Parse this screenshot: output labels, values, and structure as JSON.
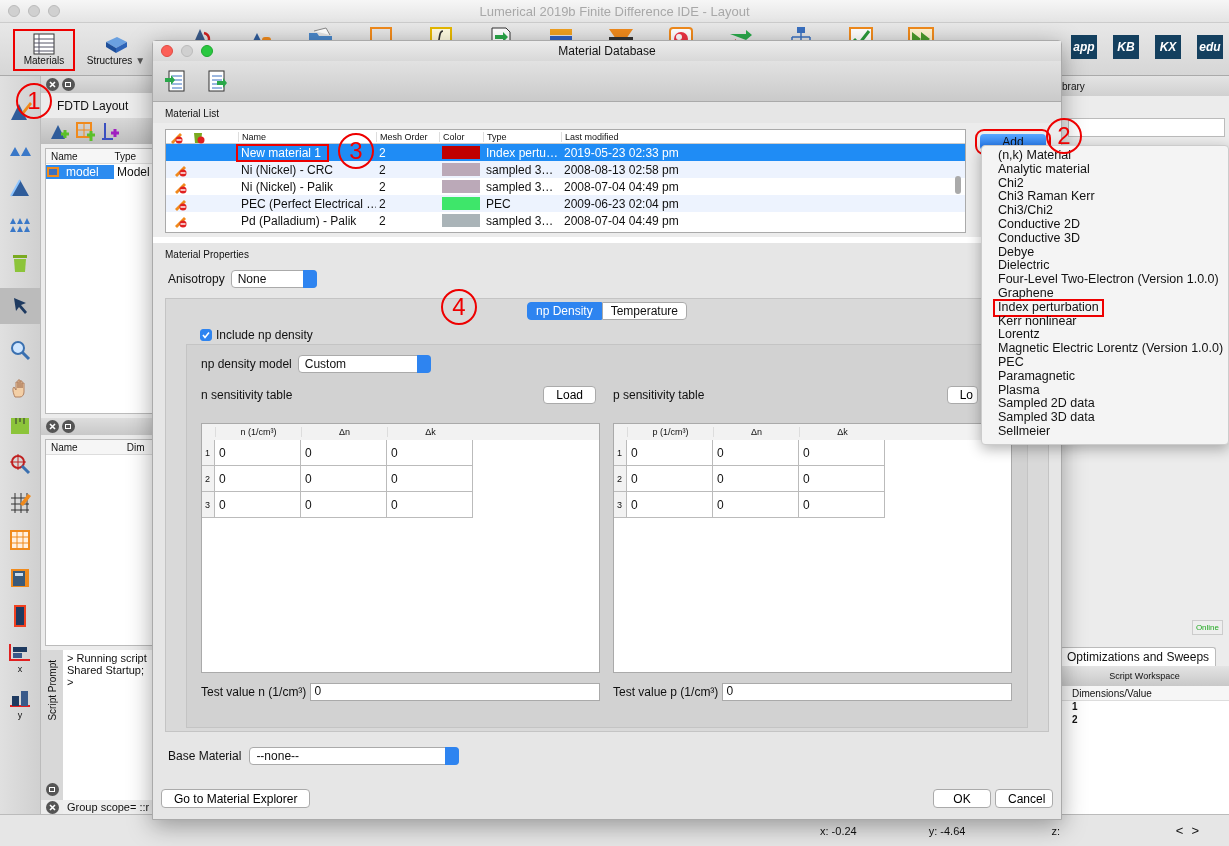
{
  "window": {
    "title": "Lumerical 2019b Finite Difference IDE - Layout"
  },
  "toolbar": {
    "buttons": [
      {
        "label": "Materials",
        "outlined": true
      },
      {
        "label": "Structures",
        "caret": "▼",
        "outlined": false
      }
    ],
    "logos": [
      "app",
      "KB",
      "KX",
      "edu"
    ]
  },
  "left_panel": {
    "title": "FDTD Layout",
    "columns": [
      "Name",
      "Type"
    ],
    "rows": [
      {
        "name": "model",
        "type": "Model",
        "selected": true
      }
    ]
  },
  "result_panel": {
    "columns": [
      "Name",
      "Dim"
    ]
  },
  "script_prompt": {
    "tab": "Script Prompt",
    "lines": [
      "> Running script",
      "Shared Startup;",
      ">"
    ],
    "scope": "Group scope= ::r"
  },
  "icon_bar": {
    "x_label": "x",
    "y_label": "y"
  },
  "right_panel": {
    "tab": "brary",
    "status": "Online",
    "tabs": [
      {
        "label": "Optimizations and Sweeps",
        "selected": true
      }
    ],
    "workspace_title": "Script Workspace",
    "columns": [
      "Dimensions/Value"
    ],
    "rows": [
      "1",
      "2"
    ]
  },
  "status_bar": {
    "x": "x: -0.24",
    "y": "y: -4.64",
    "z": "z:",
    "nav": [
      "<",
      ">"
    ]
  },
  "dialog": {
    "title": "Material Database",
    "list_label": "Material List",
    "columns": [
      "Name",
      "Mesh Order",
      "Color",
      "Type",
      "Last modified"
    ],
    "rows": [
      {
        "name": "New material 1",
        "mesh_order": "2",
        "color": "#c00000",
        "type": "Index pertu…",
        "modified": "2019-05-23 02:33 pm",
        "selected": true,
        "outlined": true,
        "removable": false
      },
      {
        "name": "Ni (Nickel) - CRC",
        "mesh_order": "2",
        "color": "#bba9b8",
        "type": "sampled 3…",
        "modified": "2008-08-13 02:58 pm",
        "selected": false,
        "outlined": false,
        "removable": true
      },
      {
        "name": "Ni (Nickel) - Palik",
        "mesh_order": "2",
        "color": "#bba9b8",
        "type": "sampled 3…",
        "modified": "2008-07-04 04:49 pm",
        "selected": false,
        "outlined": false,
        "removable": true
      },
      {
        "name": "PEC (Perfect Electrical …",
        "mesh_order": "2",
        "color": "#3ee66a",
        "type": "PEC",
        "modified": "2009-06-23 02:04 pm",
        "selected": false,
        "outlined": false,
        "removable": true
      },
      {
        "name": "Pd (Palladium) - Palik",
        "mesh_order": "2",
        "color": "#aab4b8",
        "type": "sampled 3…",
        "modified": "2008-07-04 04:49 pm",
        "selected": false,
        "outlined": false,
        "removable": true
      }
    ],
    "add_button": {
      "label": "Add",
      "outlined": true
    },
    "properties_label": "Material Properties",
    "anisotropy": {
      "label": "Anisotropy",
      "value": "None"
    },
    "tabs": [
      {
        "label": "np Density",
        "selected": true
      },
      {
        "label": "Temperature",
        "selected": false
      }
    ],
    "include": {
      "label": "Include np density",
      "checked": true
    },
    "model": {
      "label": "np density model",
      "value": "Custom"
    },
    "tables": [
      {
        "title": "n sensitivity table",
        "load": "Load",
        "columns": [
          "n (1/cm³)",
          "Δn",
          "Δk"
        ],
        "row_numbers": [
          "1",
          "2",
          "3"
        ],
        "rows": [
          [
            "0",
            "0",
            "0"
          ],
          [
            "0",
            "0",
            "0"
          ],
          [
            "0",
            "0",
            "0"
          ]
        ],
        "test_label": "Test value n (1/cm³)",
        "test_value": "0"
      },
      {
        "title": "p sensitivity table",
        "load": "Lo",
        "columns": [
          "p (1/cm³)",
          "Δn",
          "Δk"
        ],
        "row_numbers": [
          "1",
          "2",
          "3"
        ],
        "rows": [
          [
            "0",
            "0",
            "0"
          ],
          [
            "0",
            "0",
            "0"
          ],
          [
            "0",
            "0",
            "0"
          ]
        ],
        "test_label": "Test value p (1/cm³)",
        "test_value": "0"
      }
    ],
    "base_material": {
      "label": "Base Material",
      "value": "--none--"
    },
    "explorer_button": "Go to Material Explorer",
    "buttons": [
      "OK",
      "Cancel"
    ]
  },
  "add_menu": {
    "items": [
      {
        "label": "(n,k) Material",
        "outlined": false
      },
      {
        "label": "Analytic material",
        "outlined": false
      },
      {
        "label": "Chi2",
        "outlined": false
      },
      {
        "label": "Chi3 Raman Kerr",
        "outlined": false
      },
      {
        "label": "Chi3/Chi2",
        "outlined": false
      },
      {
        "label": "Conductive 2D",
        "outlined": false
      },
      {
        "label": "Conductive 3D",
        "outlined": false
      },
      {
        "label": "Debye",
        "outlined": false
      },
      {
        "label": "Dielectric",
        "outlined": false
      },
      {
        "label": "Four-Level Two-Electron (Version 1.0.0)",
        "outlined": false
      },
      {
        "label": "Graphene",
        "outlined": false
      },
      {
        "label": "Index perturbation",
        "outlined": true
      },
      {
        "label": "Kerr nonlinear",
        "outlined": false
      },
      {
        "label": "Lorentz",
        "outlined": false
      },
      {
        "label": "Magnetic Electric Lorentz (Version 1.0.0)",
        "outlined": false
      },
      {
        "label": "PEC",
        "outlined": false
      },
      {
        "label": "Paramagnetic",
        "outlined": false
      },
      {
        "label": "Plasma",
        "outlined": false
      },
      {
        "label": "Sampled 2D data",
        "outlined": false
      },
      {
        "label": "Sampled 3D data",
        "outlined": false
      },
      {
        "label": "Sellmeier",
        "outlined": false
      }
    ]
  },
  "annotations": [
    "1",
    "2",
    "3",
    "4"
  ]
}
